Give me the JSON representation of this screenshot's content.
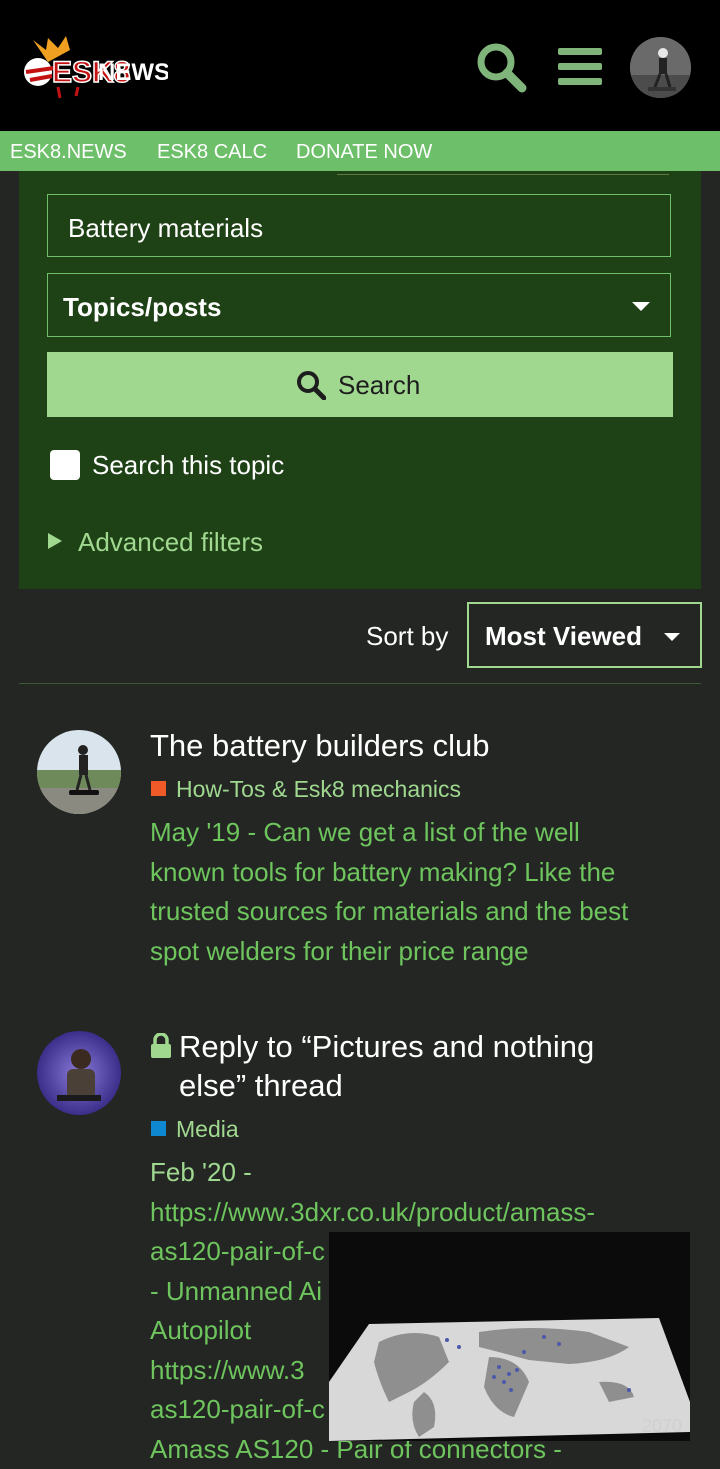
{
  "header": {
    "logo_text": "ESK8.NEWS",
    "search_icon": "search-icon",
    "menu_icon": "hamburger-menu-icon",
    "avatar": "user-avatar"
  },
  "nav": {
    "items": [
      "ESK8.NEWS",
      "ESK8 CALC",
      "DONATE NOW"
    ]
  },
  "search": {
    "query": "Battery materials",
    "scope": "Topics/posts",
    "button_label": "Search",
    "checkbox_label": "Search this topic",
    "checkbox_checked": false,
    "advanced_label": "Advanced filters"
  },
  "sort": {
    "label": "Sort by",
    "value": "Most Viewed"
  },
  "results": [
    {
      "title": "The battery builders club",
      "locked": false,
      "category": "How-Tos & Esk8 mechanics",
      "category_color": "#f05a28",
      "date": "May '19",
      "blurb_lines": [
        "May '19 - Can we get a list of the well",
        "known tools for battery making? Like the",
        "trusted sources for materials and the best",
        "spot welders for their price range"
      ]
    },
    {
      "title_lines": [
        "Reply to “Pictures and nothing",
        "else” thread"
      ],
      "locked": true,
      "category": "Media",
      "category_color": "#0e88d0",
      "date": "Feb '20",
      "blurb_lines": [
        "Feb '20 -",
        "https://www.3dxr.co.uk/product/amass-",
        "as120-pair-of-c",
        "- Unmanned Ai",
        "Autopilot",
        "https://www.3",
        "as120-pair-of-c",
        "Amass AS120 - Pair of connectors -"
      ]
    }
  ],
  "video_overlay": {
    "counter": "2070"
  },
  "colors": {
    "background": "#232623",
    "panel": "#1e4216",
    "accent": "#a0d890",
    "nav": "#6ebf6a",
    "link_text": "#6ec45d"
  }
}
